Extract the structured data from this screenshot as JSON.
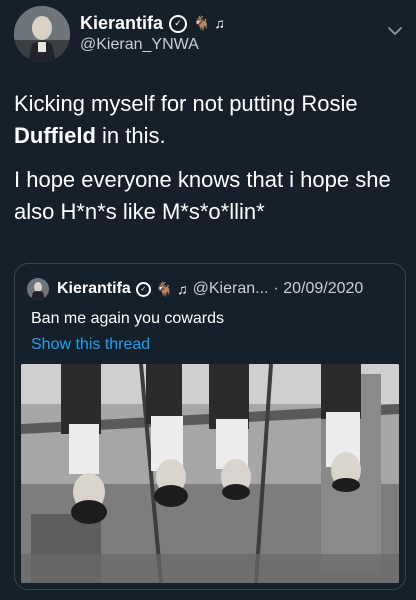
{
  "header": {
    "display_name": "Kierantifa",
    "verified_glyph": "✓",
    "emojis": "🐐 ♫",
    "handle": "@Kieran_YNWA",
    "menu_icon": "chevron-down-icon"
  },
  "tweet": {
    "line1_before": "Kicking myself for not putting Rosie ",
    "line1_bold": "Duffield",
    "line1_after": " in this.",
    "line2": "I hope everyone knows that i hope she also H*n*s like M*s*o*llin*"
  },
  "quote": {
    "display_name": "Kierantifa",
    "verified_glyph": "✓",
    "emojis": "🐐 ♫",
    "handle_truncated": "@Kieran...",
    "date": "· 20/09/2020",
    "text": "Ban me again you cowards",
    "show_thread": "Show this thread"
  },
  "colors": {
    "background": "#15202b",
    "link": "#1da1f2",
    "border": "#3a4653"
  }
}
